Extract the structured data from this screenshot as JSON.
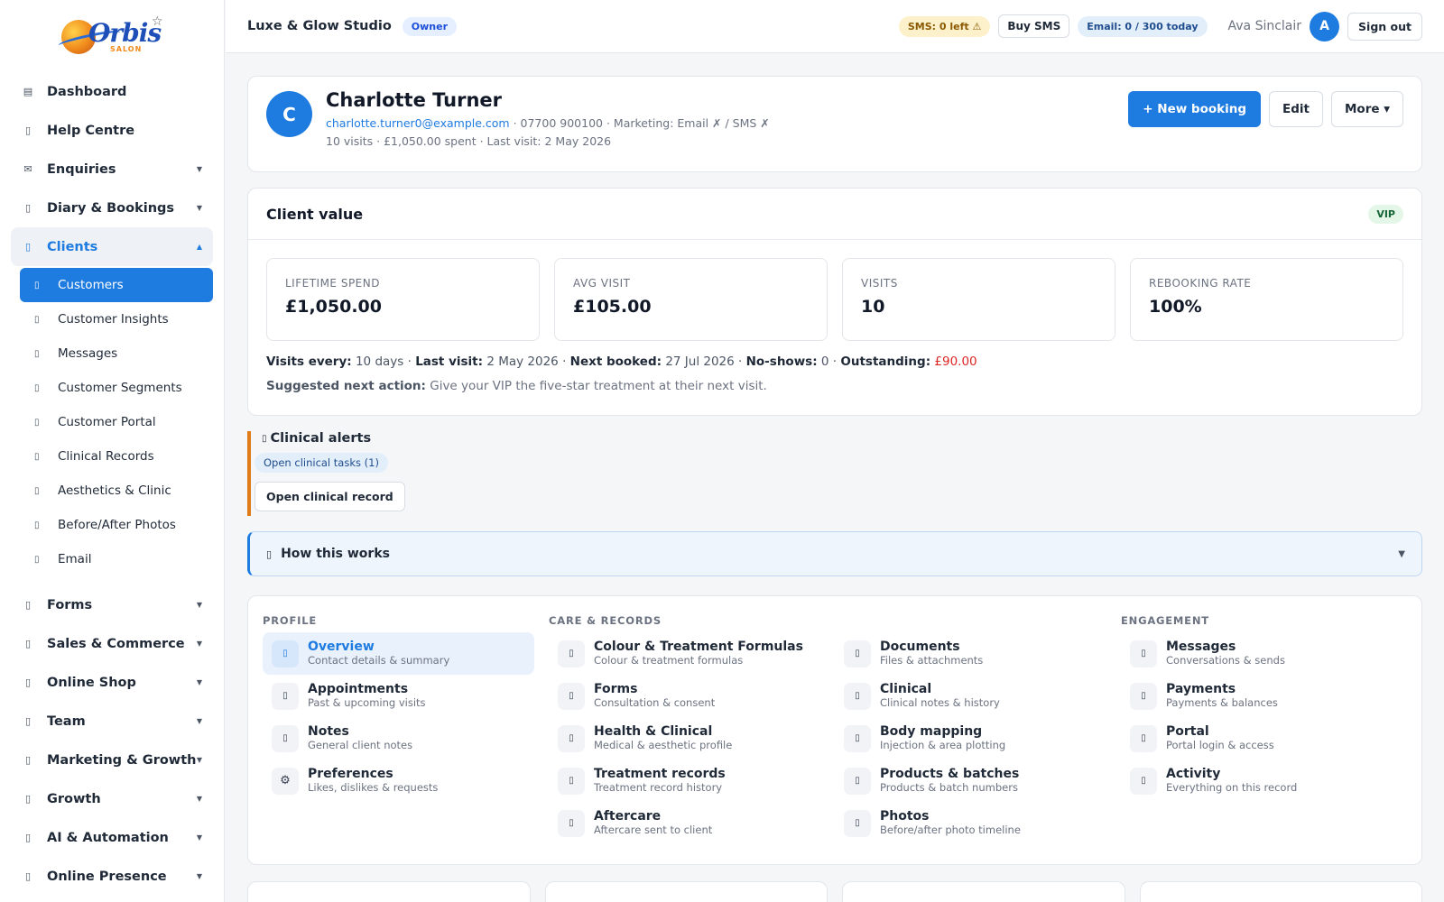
{
  "brand": {
    "logo_text": "Orbis",
    "logo_sub": "SALON"
  },
  "sidebar": {
    "items": [
      {
        "label": "Dashboard",
        "icon": "grid-icon",
        "caret": false
      },
      {
        "label": "Help Centre",
        "icon": "help-icon",
        "caret": false
      },
      {
        "label": "Enquiries",
        "icon": "envelope-icon",
        "caret": true
      },
      {
        "label": "Diary & Bookings",
        "icon": "calendar-icon",
        "caret": true
      },
      {
        "label": "Clients",
        "icon": "users-icon",
        "caret": true,
        "expanded": true
      }
    ],
    "client_subitems": [
      {
        "label": "Customers",
        "active": true
      },
      {
        "label": "Customer Insights"
      },
      {
        "label": "Messages"
      },
      {
        "label": "Customer Segments"
      },
      {
        "label": "Customer Portal"
      },
      {
        "label": "Clinical Records"
      },
      {
        "label": "Aesthetics & Clinic"
      },
      {
        "label": "Before/After Photos"
      },
      {
        "label": "Email"
      }
    ],
    "lower_items": [
      {
        "label": "Forms"
      },
      {
        "label": "Sales & Commerce"
      },
      {
        "label": "Online Shop"
      },
      {
        "label": "Team"
      },
      {
        "label": "Marketing & Growth"
      },
      {
        "label": "Growth"
      },
      {
        "label": "AI & Automation"
      },
      {
        "label": "Online Presence"
      }
    ]
  },
  "topbar": {
    "studio": "Luxe & Glow Studio",
    "role": "Owner",
    "sms": "SMS: 0 left ⚠",
    "buy_sms": "Buy SMS",
    "email": "Email: 0 / 300 today",
    "user": "Ava Sinclair",
    "user_initial": "A",
    "sign_out": "Sign out"
  },
  "client": {
    "initial": "C",
    "name": "Charlotte Turner",
    "email": "charlotte.turner0@example.com",
    "contact_rest": " · 07700 900100 · Marketing: Email ✗ / SMS ✗",
    "summary": "10 visits · £1,050.00 spent · Last visit: 2 May 2026",
    "new_booking": "+ New booking",
    "edit": "Edit",
    "more": "More ▾"
  },
  "value": {
    "title": "Client value",
    "tier": "VIP",
    "stats": [
      {
        "label": "LIFETIME SPEND",
        "value": "£1,050.00"
      },
      {
        "label": "AVG VISIT",
        "value": "£105.00"
      },
      {
        "label": "VISITS",
        "value": "10"
      },
      {
        "label": "REBOOKING RATE",
        "value": "100%"
      }
    ],
    "visits_every_label": "Visits every:",
    "visits_every": "10 days",
    "last_visit_label": "Last visit:",
    "last_visit": "2 May 2026",
    "next_booked_label": "Next booked:",
    "next_booked": "27 Jul 2026",
    "no_shows_label": "No-shows:",
    "no_shows": "0",
    "outstanding_label": "Outstanding:",
    "outstanding": "£90.00",
    "suggested_label": "Suggested next action:",
    "suggested": "Give your VIP the five-star treatment at their next visit."
  },
  "alerts": {
    "title": "Clinical alerts",
    "chip": "Open clinical tasks (1)",
    "button": "Open clinical record"
  },
  "how": {
    "title": "How this works"
  },
  "sections": [
    {
      "title": "PROFILE",
      "items": [
        {
          "name": "Overview",
          "desc": "Contact details & summary",
          "active": true
        },
        {
          "name": "Appointments",
          "desc": "Past & upcoming visits"
        },
        {
          "name": "Notes",
          "desc": "General client notes"
        },
        {
          "name": "Preferences",
          "desc": "Likes, dislikes & requests",
          "icon": "⚙"
        }
      ]
    },
    {
      "title": "CARE & RECORDS",
      "items": [
        {
          "name": "Colour & Treatment Formulas",
          "desc": "Colour & treatment formulas"
        },
        {
          "name": "Forms",
          "desc": "Consultation & consent"
        },
        {
          "name": "Health & Clinical",
          "desc": "Medical & aesthetic profile"
        },
        {
          "name": "Treatment records",
          "desc": "Treatment record history"
        },
        {
          "name": "Aftercare",
          "desc": "Aftercare sent to client"
        }
      ]
    },
    {
      "title": "",
      "items": [
        {
          "name": "Documents",
          "desc": "Files & attachments"
        },
        {
          "name": "Clinical",
          "desc": "Clinical notes & history"
        },
        {
          "name": "Body mapping",
          "desc": "Injection & area plotting"
        },
        {
          "name": "Products & batches",
          "desc": "Products & batch numbers"
        },
        {
          "name": "Photos",
          "desc": "Before/after photo timeline"
        }
      ]
    },
    {
      "title": "ENGAGEMENT",
      "items": [
        {
          "name": "Messages",
          "desc": "Conversations & sends"
        },
        {
          "name": "Payments",
          "desc": "Payments & balances"
        },
        {
          "name": "Portal",
          "desc": "Portal login & access"
        },
        {
          "name": "Activity",
          "desc": "Everything on this record"
        }
      ]
    }
  ],
  "colors": {
    "accent": "#1e7be0",
    "warning": "#e07b1a",
    "danger": "#dc2626"
  }
}
